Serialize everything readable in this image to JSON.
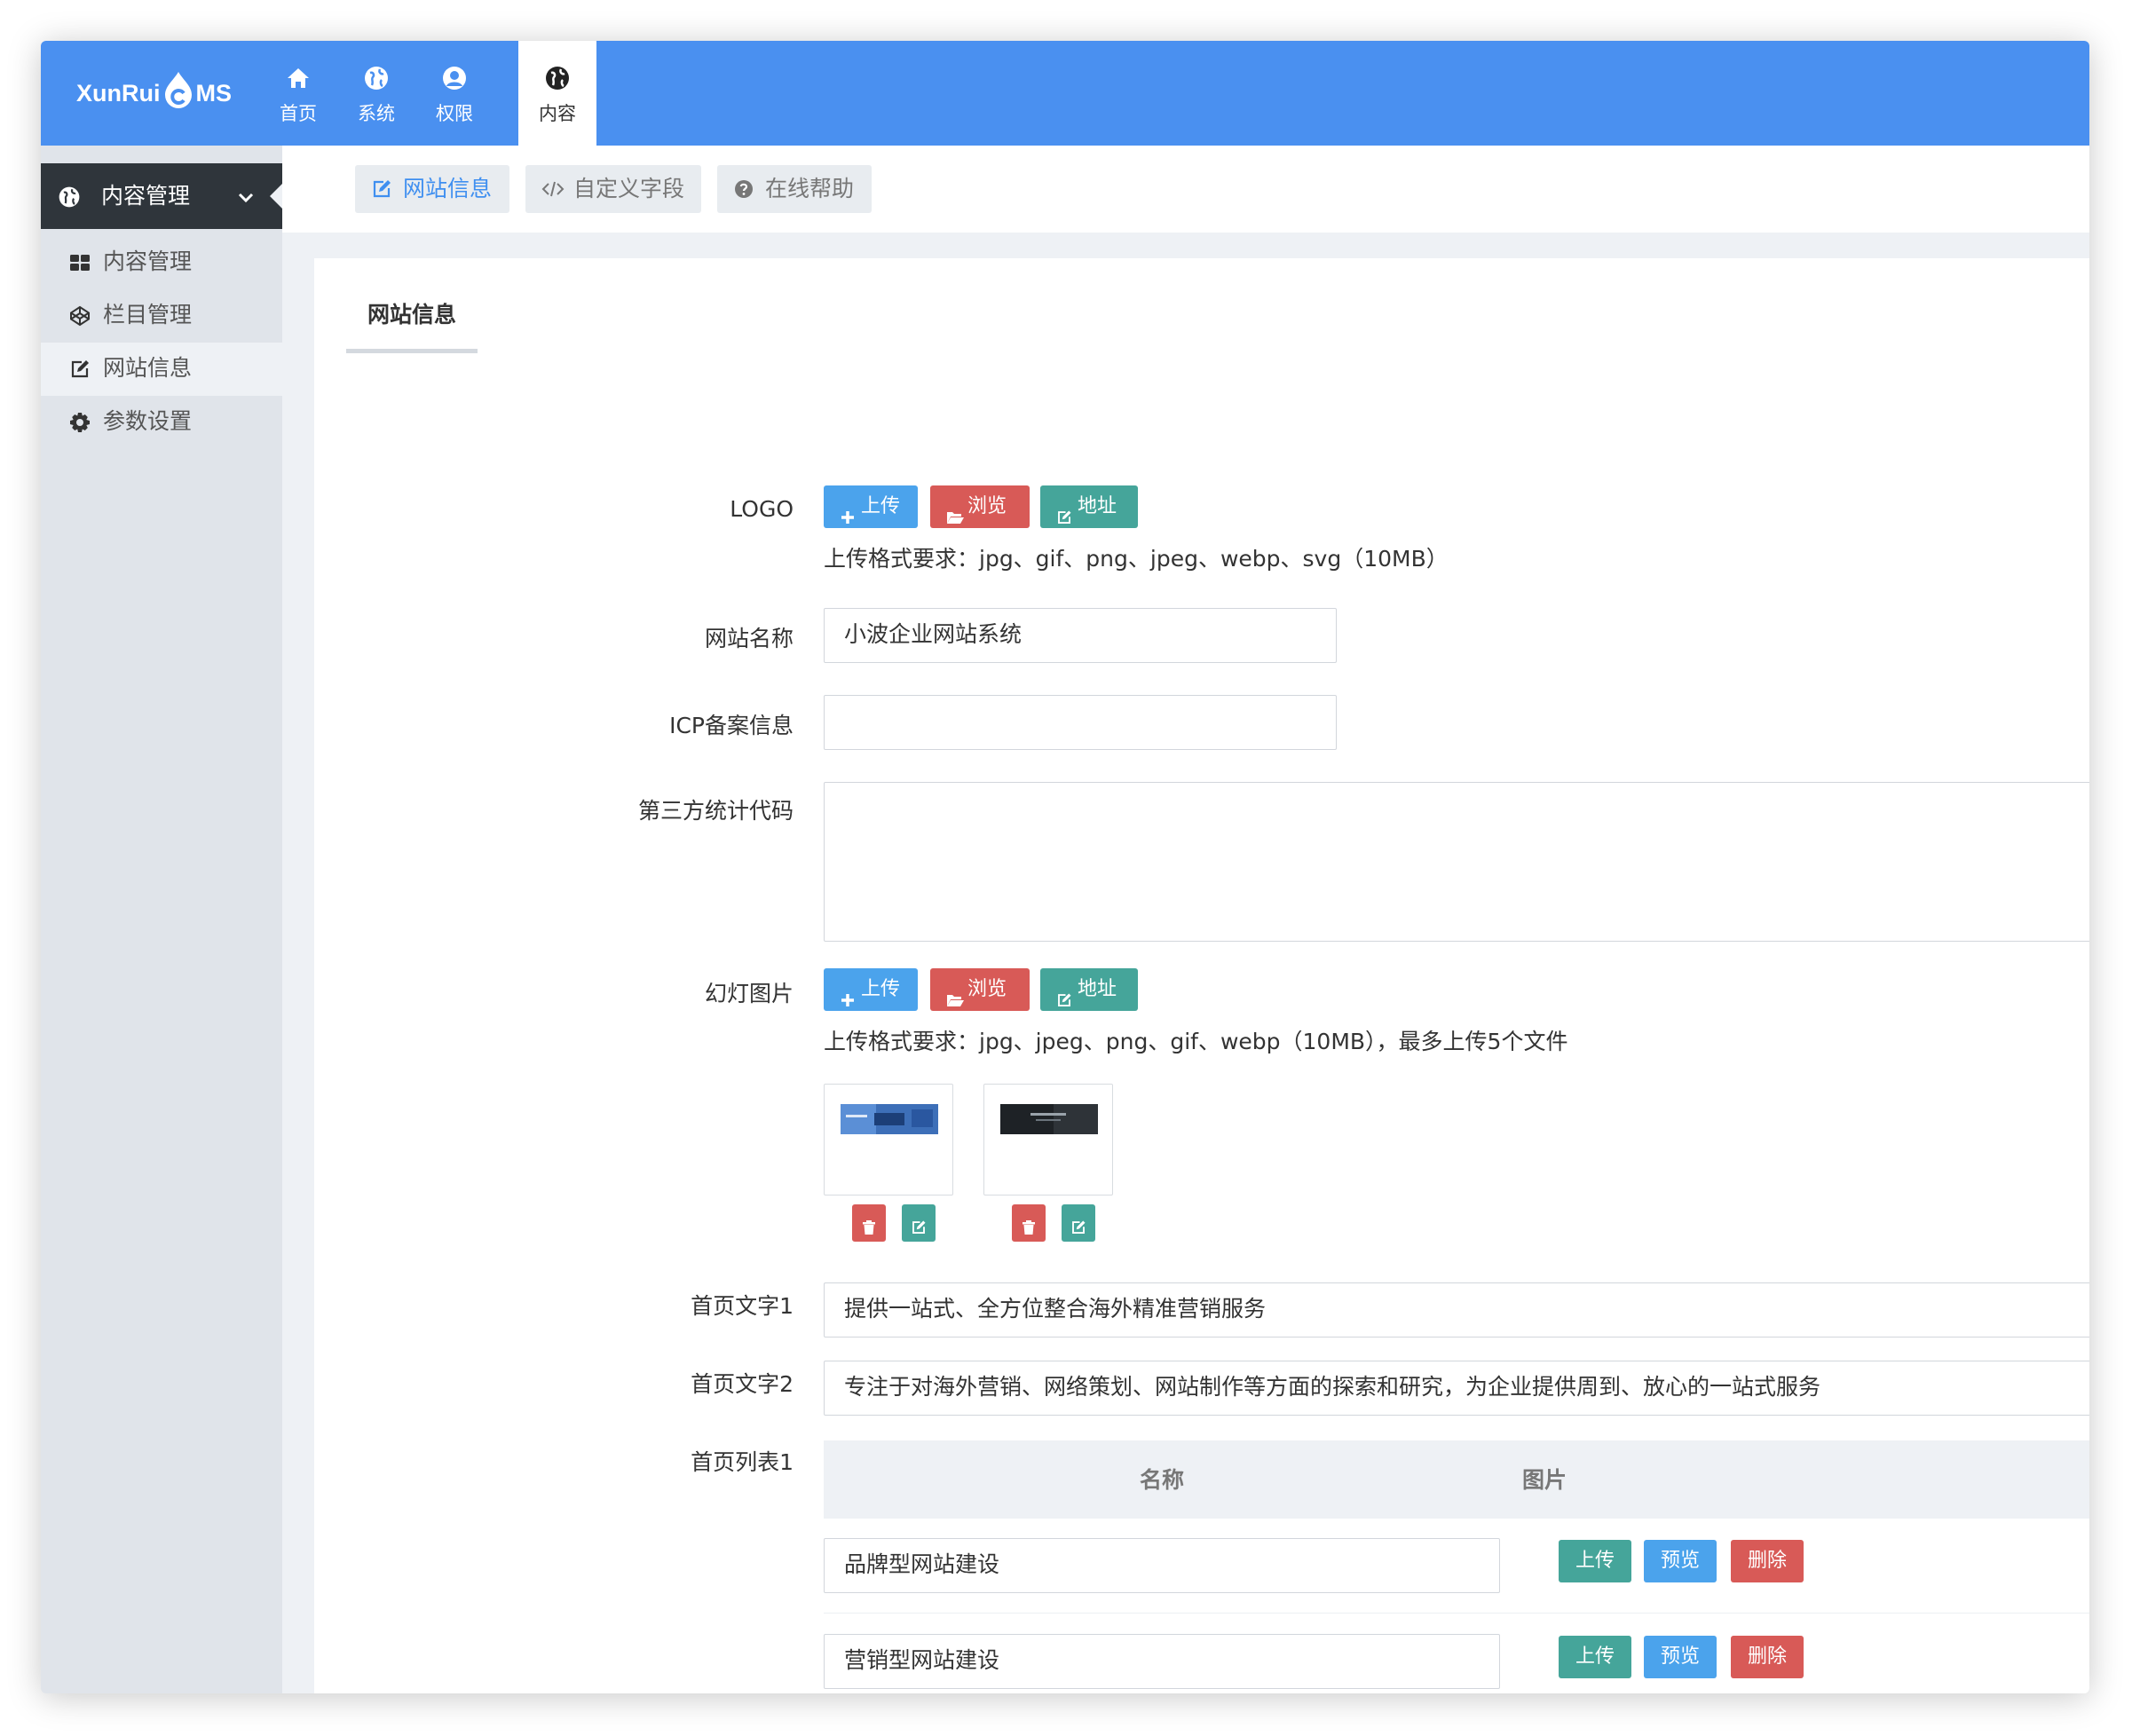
{
  "app": {
    "logo_text_left": "XunRui",
    "logo_text_right": "MS",
    "brand_color": "#4a90f0"
  },
  "nav": {
    "tabs": [
      {
        "label": "首页",
        "icon": "home-icon"
      },
      {
        "label": "系统",
        "icon": "globe-icon"
      },
      {
        "label": "权限",
        "icon": "user-circle-icon"
      },
      {
        "label": "内容",
        "icon": "globe-icon",
        "active": true
      }
    ]
  },
  "sidebar": {
    "section": {
      "label": "内容管理",
      "icon": "globe-icon"
    },
    "items": [
      {
        "label": "内容管理",
        "icon": "th-large-icon"
      },
      {
        "label": "栏目管理",
        "icon": "codepen-icon"
      },
      {
        "label": "网站信息",
        "icon": "edit-icon",
        "active": true
      },
      {
        "label": "参数设置",
        "icon": "gear-icon"
      }
    ]
  },
  "subtabs": [
    {
      "label": "网站信息",
      "icon": "edit-icon",
      "active": true
    },
    {
      "label": "自定义字段",
      "icon": "code-icon"
    },
    {
      "label": "在线帮助",
      "icon": "question-circle-icon"
    }
  ],
  "card": {
    "title": "网站信息"
  },
  "form": {
    "logo": {
      "label": "LOGO",
      "buttons": {
        "upload": "上传",
        "browse": "浏览",
        "address": "地址"
      },
      "hint": "上传格式要求：jpg、gif、png、jpeg、webp、svg（10MB）"
    },
    "site_name": {
      "label": "网站名称",
      "value": "小波企业网站系统"
    },
    "icp": {
      "label": "ICP备案信息",
      "value": ""
    },
    "stats_code": {
      "label": "第三方统计代码",
      "value": ""
    },
    "slides": {
      "label": "幻灯图片",
      "buttons": {
        "upload": "上传",
        "browse": "浏览",
        "address": "地址"
      },
      "hint": "上传格式要求：jpg、jpeg、png、gif、webp（10MB），最多上传5个文件",
      "images": [
        {
          "alt": "slide-1",
          "tone": "#3d6fb8"
        },
        {
          "alt": "slide-2",
          "tone": "#1e2226"
        }
      ]
    },
    "home_text1": {
      "label": "首页文字1",
      "value": "提供一站式、全方位整合海外精准营销服务"
    },
    "home_text2": {
      "label": "首页文字2",
      "value": "专注于对海外营销、网络策划、网站制作等方面的探索和研究，为企业提供周到、放心的一站式服务"
    },
    "home_list1": {
      "label": "首页列表1",
      "columns": {
        "name": "名称",
        "image": "图片"
      },
      "row_buttons": {
        "upload": "上传",
        "preview": "预览",
        "delete": "删除"
      },
      "rows": [
        {
          "name": "品牌型网站建设"
        },
        {
          "name": "营销型网站建设"
        }
      ]
    }
  },
  "colors": {
    "blue_button": "#4ba3ec",
    "red_button": "#d85a57",
    "teal_button": "#45a59a",
    "sidebar_dark": "#2f353b"
  }
}
